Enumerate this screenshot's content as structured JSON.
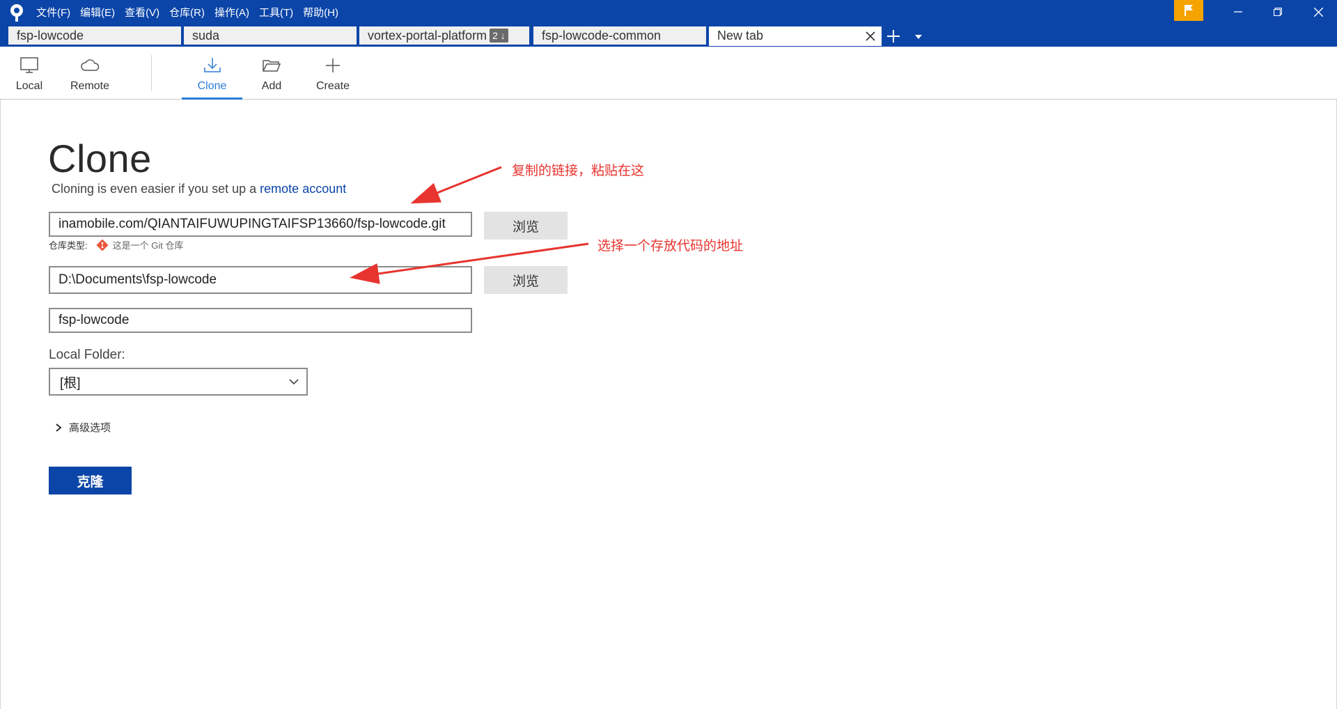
{
  "menu": [
    "文件(F)",
    "编辑(E)",
    "查看(V)",
    "仓库(R)",
    "操作(A)",
    "工具(T)",
    "帮助(H)"
  ],
  "tabs": [
    {
      "label": "fsp-lowcode"
    },
    {
      "label": "suda"
    },
    {
      "label": "vortex-portal-platform",
      "badge": "2 ↓"
    },
    {
      "label": "fsp-lowcode-common"
    },
    {
      "label": "New tab",
      "active": true
    }
  ],
  "toolbar": {
    "local": "Local",
    "remote": "Remote",
    "clone": "Clone",
    "add": "Add",
    "create": "Create",
    "active": "Clone"
  },
  "clone_page": {
    "title": "Clone",
    "subtitle_text": "Cloning is even easier if you set up a ",
    "subtitle_link": "remote account",
    "source_url": "inamobile.com/QIANTAIFUWUPINGTAIFSP13660/fsp-lowcode.git",
    "browse_label": "浏览",
    "repo_type_label": "仓库类型:",
    "repo_type_value": "这是一个 Git 仓库",
    "destination_path": "D:\\Documents\\fsp-lowcode",
    "name": "fsp-lowcode",
    "local_folder_label": "Local Folder:",
    "local_folder_value": "[根]",
    "advanced_label": "高级选项",
    "clone_button": "克隆"
  },
  "annotations": {
    "paste_link": "复制的链接，粘贴在这",
    "choose_path": "选择一个存放代码的地址"
  },
  "colors": {
    "brand": "#0b45a8",
    "accent": "#2a7ad6",
    "flag": "#f5a300",
    "annotation": "#e8342f"
  }
}
